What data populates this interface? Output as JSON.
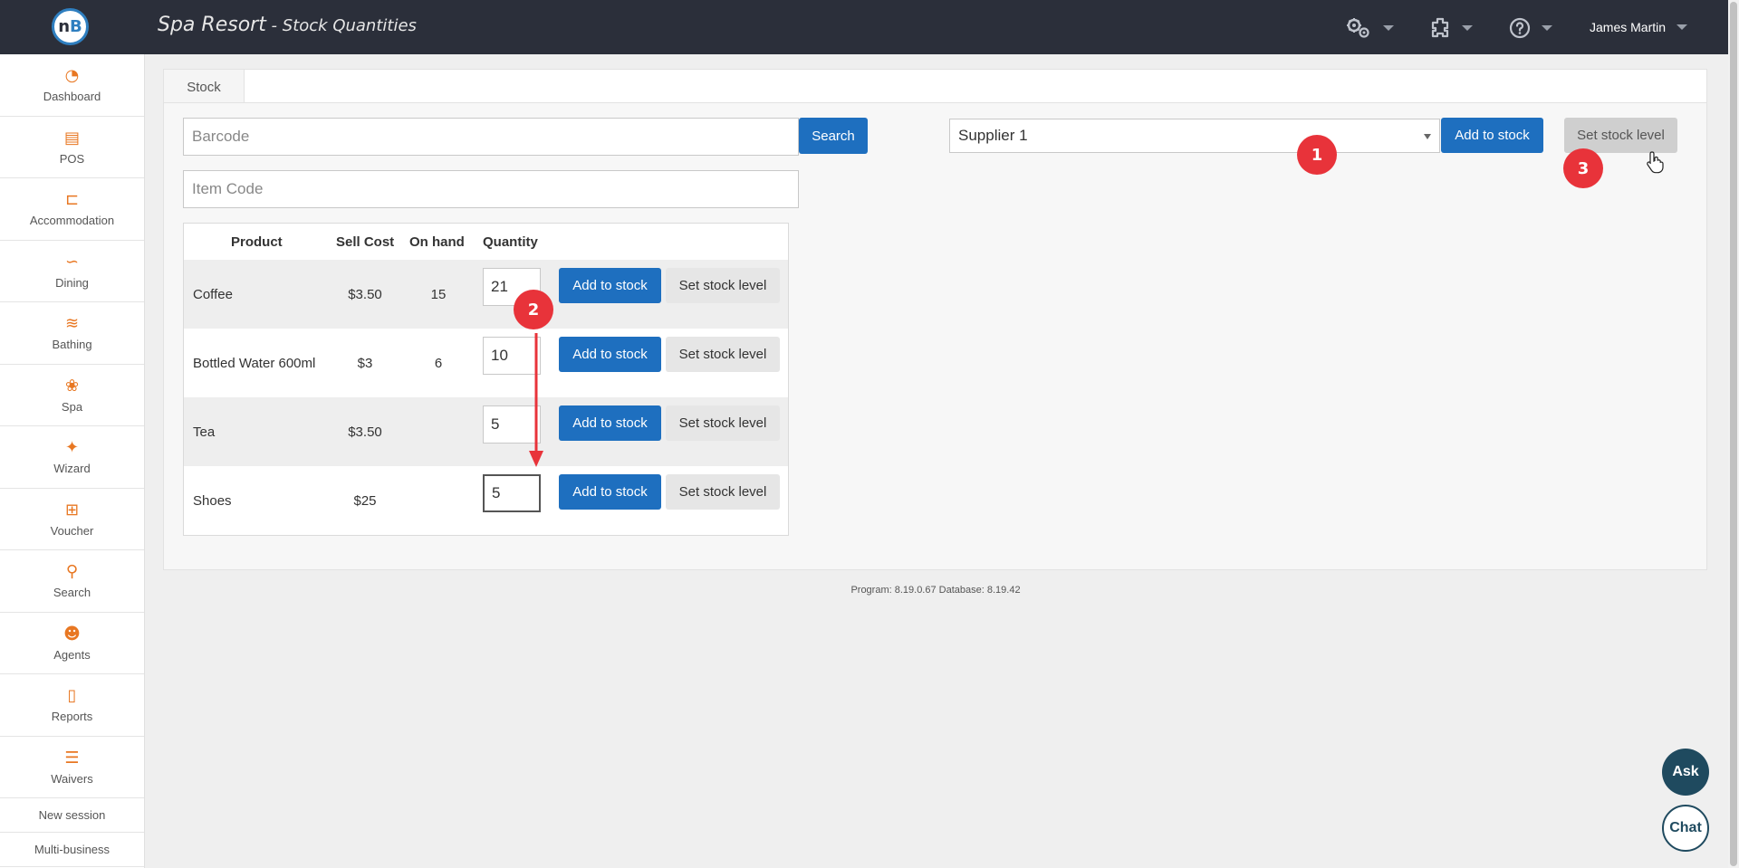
{
  "header": {
    "logo_text": "n",
    "logo_accent": "B",
    "app_name": "Spa Resort",
    "separator": " - ",
    "page_name": "Stock Quantities",
    "icons": [
      "gears-icon",
      "plugin-icon",
      "help-icon"
    ],
    "user_name": "James Martin"
  },
  "sidebar": {
    "items": [
      {
        "label": "Dashboard",
        "icon": "dashboard-icon"
      },
      {
        "label": "POS",
        "icon": "register-icon"
      },
      {
        "label": "Accommodation",
        "icon": "bed-icon"
      },
      {
        "label": "Dining",
        "icon": "dining-icon"
      },
      {
        "label": "Bathing",
        "icon": "waves-icon"
      },
      {
        "label": "Spa",
        "icon": "lotus-icon"
      },
      {
        "label": "Wizard",
        "icon": "wand-icon"
      },
      {
        "label": "Voucher",
        "icon": "gift-icon"
      },
      {
        "label": "Search",
        "icon": "search-icon"
      },
      {
        "label": "Agents",
        "icon": "agents-icon"
      },
      {
        "label": "Reports",
        "icon": "report-icon"
      },
      {
        "label": "Waivers",
        "icon": "checklist-icon"
      }
    ],
    "text_links": [
      "New session",
      "Multi-business"
    ]
  },
  "tabs": [
    {
      "label": "Stock"
    }
  ],
  "barcode": {
    "placeholder": "Barcode",
    "search_label": "Search"
  },
  "item_code": {
    "placeholder": "Item Code"
  },
  "supplier": {
    "selected": "Supplier 1",
    "add_label": "Add to stock",
    "set_label": "Set stock level"
  },
  "table": {
    "headers": {
      "product": "Product",
      "sell_cost": "Sell Cost",
      "on_hand": "On hand",
      "quantity": "Quantity"
    },
    "add_label": "Add to stock",
    "set_label": "Set stock level",
    "rows": [
      {
        "product": "Coffee",
        "sell_cost": "$3.50",
        "on_hand": "15",
        "quantity": "21"
      },
      {
        "product": "Bottled Water 600ml",
        "sell_cost": "$3",
        "on_hand": "6",
        "quantity": "10"
      },
      {
        "product": "Tea",
        "sell_cost": "$3.50",
        "on_hand": "",
        "quantity": "5"
      },
      {
        "product": "Shoes",
        "sell_cost": "$25",
        "on_hand": "",
        "quantity": "5"
      }
    ]
  },
  "footer": {
    "version": "Program: 8.19.0.67 Database: 8.19.42"
  },
  "annotations": {
    "badge1": "1",
    "badge2": "2",
    "badge3": "3"
  },
  "fab": {
    "ask": "Ask",
    "chat": "Chat"
  },
  "colors": {
    "header_bg": "#2b2f3a",
    "accent_orange": "#e87722",
    "primary_blue": "#1e6fbf",
    "badge_red": "#e8333a"
  }
}
